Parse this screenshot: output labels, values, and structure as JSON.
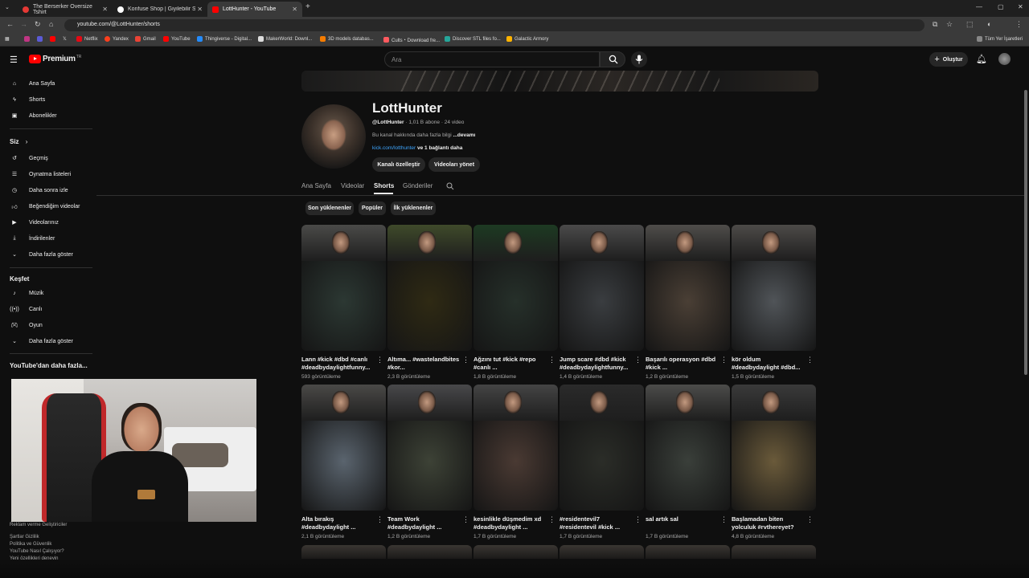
{
  "browser": {
    "tabs": [
      {
        "title": "The Berserker Oversize Tshirt",
        "color": "#e53935"
      },
      {
        "title": "Konfuse Shop | Giyilebilir Sanat!",
        "color": "#ffffff"
      },
      {
        "title": "LottHunter - YouTube",
        "color": "#ff0000"
      }
    ],
    "new_tab": "+",
    "url": "youtube.com/@LottHunter/shorts",
    "bookmarks": [
      {
        "label": "Netflix",
        "color": "#e50914"
      },
      {
        "label": "Yandex",
        "color": "#fc3f1d"
      },
      {
        "label": "Gmail",
        "color": "#ea4335"
      },
      {
        "label": "YouTube",
        "color": "#ff0000"
      },
      {
        "label": "Thingiverse - Digital...",
        "color": "#248bfb"
      },
      {
        "label": "MakerWorld: Downl...",
        "color": "#dddddd"
      },
      {
        "label": "3D models databas...",
        "color": "#f57c00"
      },
      {
        "label": "Cults・Download fre...",
        "color": "#ff5a5f"
      },
      {
        "label": "Discover STL files fo...",
        "color": "#26a69a"
      },
      {
        "label": "Galactic Armory",
        "color": "#ffb300"
      }
    ],
    "all_bookmarks": "Tüm Yer İşaretleri"
  },
  "header": {
    "logo": "Premium",
    "logo_sup": "TR",
    "search_placeholder": "Ara",
    "create": "Oluştur"
  },
  "sidebar": {
    "main": [
      {
        "label": "Ana Sayfa",
        "icon": "home-icon"
      },
      {
        "label": "Shorts",
        "icon": "shorts-icon"
      },
      {
        "label": "Abonelikler",
        "icon": "subscriptions-icon"
      }
    ],
    "you_heading": "Siz",
    "you": [
      {
        "label": "Geçmiş",
        "icon": "history-icon"
      },
      {
        "label": "Oynatma listeleri",
        "icon": "playlist-icon"
      },
      {
        "label": "Daha sonra izle",
        "icon": "clock-icon"
      },
      {
        "label": "Beğendiğim videolar",
        "icon": "like-icon"
      },
      {
        "label": "Videolarınız",
        "icon": "video-icon"
      },
      {
        "label": "İndirilenler",
        "icon": "download-icon"
      },
      {
        "label": "Daha fazla göster",
        "icon": "chevron-down-icon"
      }
    ],
    "explore_heading": "Keşfet",
    "explore": [
      {
        "label": "Müzik",
        "icon": "music-icon"
      },
      {
        "label": "Canlı",
        "icon": "live-icon"
      },
      {
        "label": "Oyun",
        "icon": "gaming-icon"
      },
      {
        "label": "Daha fazla göster",
        "icon": "chevron-down-icon"
      }
    ],
    "more_heading": "YouTube'dan daha fazla...",
    "footer": [
      "Reklam verme   Geliştiriciler",
      "Şartlar   Gizlilik",
      "Politika ve Güvenlik",
      "YouTube Nasıl Çalışıyor?",
      "Yeni özellikleri deneyin"
    ]
  },
  "channel": {
    "name": "LottHunter",
    "handle": "@LottHunter",
    "stats": "· 1,01 B abone · 24 video",
    "about": "Bu kanal hakkında daha fazla bilgi",
    "about_more": "...devamı",
    "link": "kick.com/lotthunter",
    "link_more": "ve 1 bağlantı daha",
    "btn_customize": "Kanalı özelleştir",
    "btn_manage": "Videoları yönet",
    "tabs": [
      "Ana Sayfa",
      "Videolar",
      "Shorts",
      "Gönderiler"
    ],
    "active_tab": "Shorts",
    "filters": [
      "Son yüklenenler",
      "Popüler",
      "İlk yüklenenler"
    ]
  },
  "shorts": [
    {
      "title": "Lann #kick #dbd #canlı #deadbydaylightfunny...",
      "views": "593 görüntüleme",
      "cam": "#4a4a48",
      "game": "#2c3833"
    },
    {
      "title": "Altıma... #wastelandbites #kor...",
      "views": "2,3 B görüntüleme",
      "cam": "#3f4a2a",
      "game": "#2f2a14"
    },
    {
      "title": "Ağzını tut #kick #repo #canlı ...",
      "views": "1,8 B görüntüleme",
      "cam": "#1d3a22",
      "game": "#26302a"
    },
    {
      "title": "Jump scare #dbd #kick #deadbydaylightfunny...",
      "views": "1,4 B görüntüleme",
      "cam": "#4b4a4a",
      "game": "#3a3d40"
    },
    {
      "title": "Başarılı operasyon #dbd #kick ...",
      "views": "1,2 B görüntüleme",
      "cam": "#4f4d4a",
      "game": "#4a3f35"
    },
    {
      "title": "kör oldum #deadbydaylight #dbd...",
      "views": "1,5 B görüntüleme",
      "cam": "#4d4b48",
      "game": "#505458"
    },
    {
      "title": "Alta bırakış #deadbydaylight ...",
      "views": "2,1 B görüntüleme",
      "cam": "#4a4947",
      "game": "#5a646e"
    },
    {
      "title": "Team Work #deadbydaylight ...",
      "views": "1,2 B görüntüleme",
      "cam": "#48484a",
      "game": "#3d4236"
    },
    {
      "title": "kesinlikle düşmedim xd #deadbydaylight ...",
      "views": "1,7 B görüntüleme",
      "cam": "#444444",
      "game": "#4a3a33"
    },
    {
      "title": "#residentevil7 #residentevil #kick ...",
      "views": "1,7 B görüntüleme",
      "cam": "#2a2a2a",
      "game": "#2b2d28"
    },
    {
      "title": "sal artık sal",
      "views": "1,7 B görüntüleme",
      "cam": "#4c4c4a",
      "game": "#3a3f3a"
    },
    {
      "title": "Başlamadan biten yolculuk #rvthereyet?",
      "views": "4,8 B görüntüleme",
      "cam": "#3a3a3a",
      "game": "#6a5a3a"
    }
  ]
}
